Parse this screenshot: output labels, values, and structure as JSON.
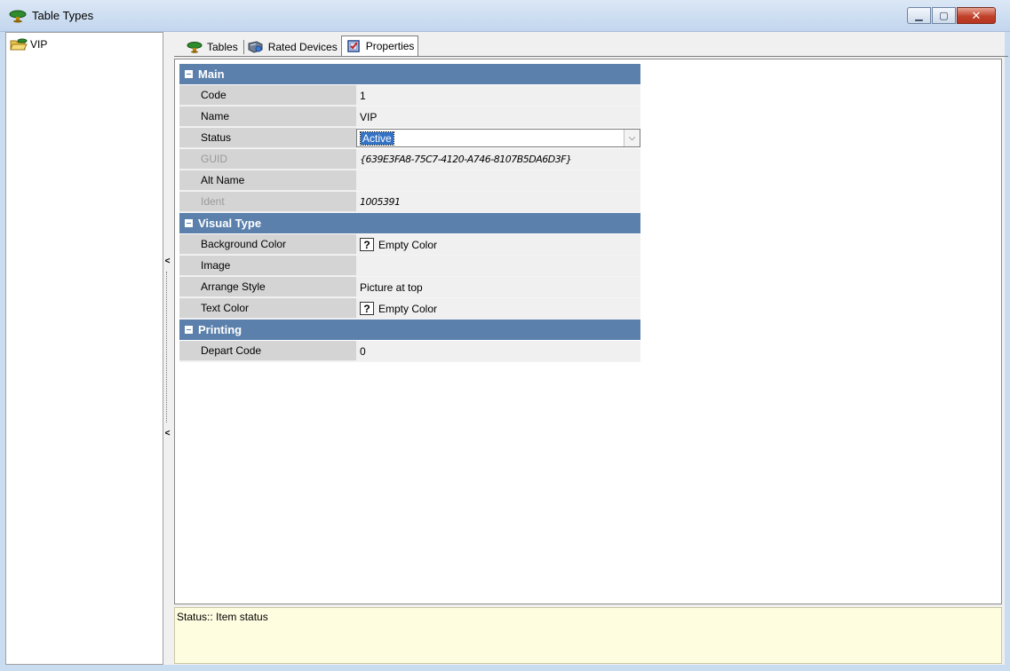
{
  "window": {
    "title": "Table Types",
    "minimize_glyph": "▁",
    "maximize_glyph": "▢",
    "close_glyph": "✕"
  },
  "tree": {
    "items": [
      {
        "label": "VIP",
        "icon": "open-folder-table-icon"
      }
    ]
  },
  "tabs": [
    {
      "label": "Tables",
      "icon": "table-icon",
      "active": false
    },
    {
      "label": "Rated Devices",
      "icon": "rated-device-icon",
      "active": false
    },
    {
      "label": "Properties",
      "icon": "properties-checklist-icon",
      "active": true
    }
  ],
  "splitter": {
    "collapse_glyph_top": "<",
    "collapse_glyph_bottom": "<"
  },
  "property_grid": {
    "main": {
      "label": "Main",
      "code": {
        "name": "Code",
        "value": "1"
      },
      "name": {
        "name": "Name",
        "value": "VIP"
      },
      "status": {
        "name": "Status",
        "value": "Active"
      },
      "guid": {
        "name": "GUID",
        "value": "{639E3FA8-75C7-4120-A746-8107B5DA6D3F}"
      },
      "alt_name": {
        "name": "Alt Name",
        "value": ""
      },
      "ident": {
        "name": "Ident",
        "value": "1005391"
      }
    },
    "visual_type": {
      "label": "Visual Type",
      "background_color": {
        "name": "Background Color",
        "value": "Empty Color"
      },
      "image": {
        "name": "Image",
        "value": ""
      },
      "arrange_style": {
        "name": "Arrange Style",
        "value": "Picture at top"
      },
      "text_color": {
        "name": "Text Color",
        "value": "Empty Color"
      }
    },
    "printing": {
      "label": "Printing",
      "depart_code": {
        "name": "Depart Code",
        "value": "0"
      }
    },
    "color_glyph": "?",
    "dropdown_glyph": "⌵"
  },
  "description": {
    "text": "Status:: Item status"
  },
  "colors": {
    "category_header": "#5b80ac",
    "selection": "#3372c4",
    "description_bg": "#fffde0"
  }
}
